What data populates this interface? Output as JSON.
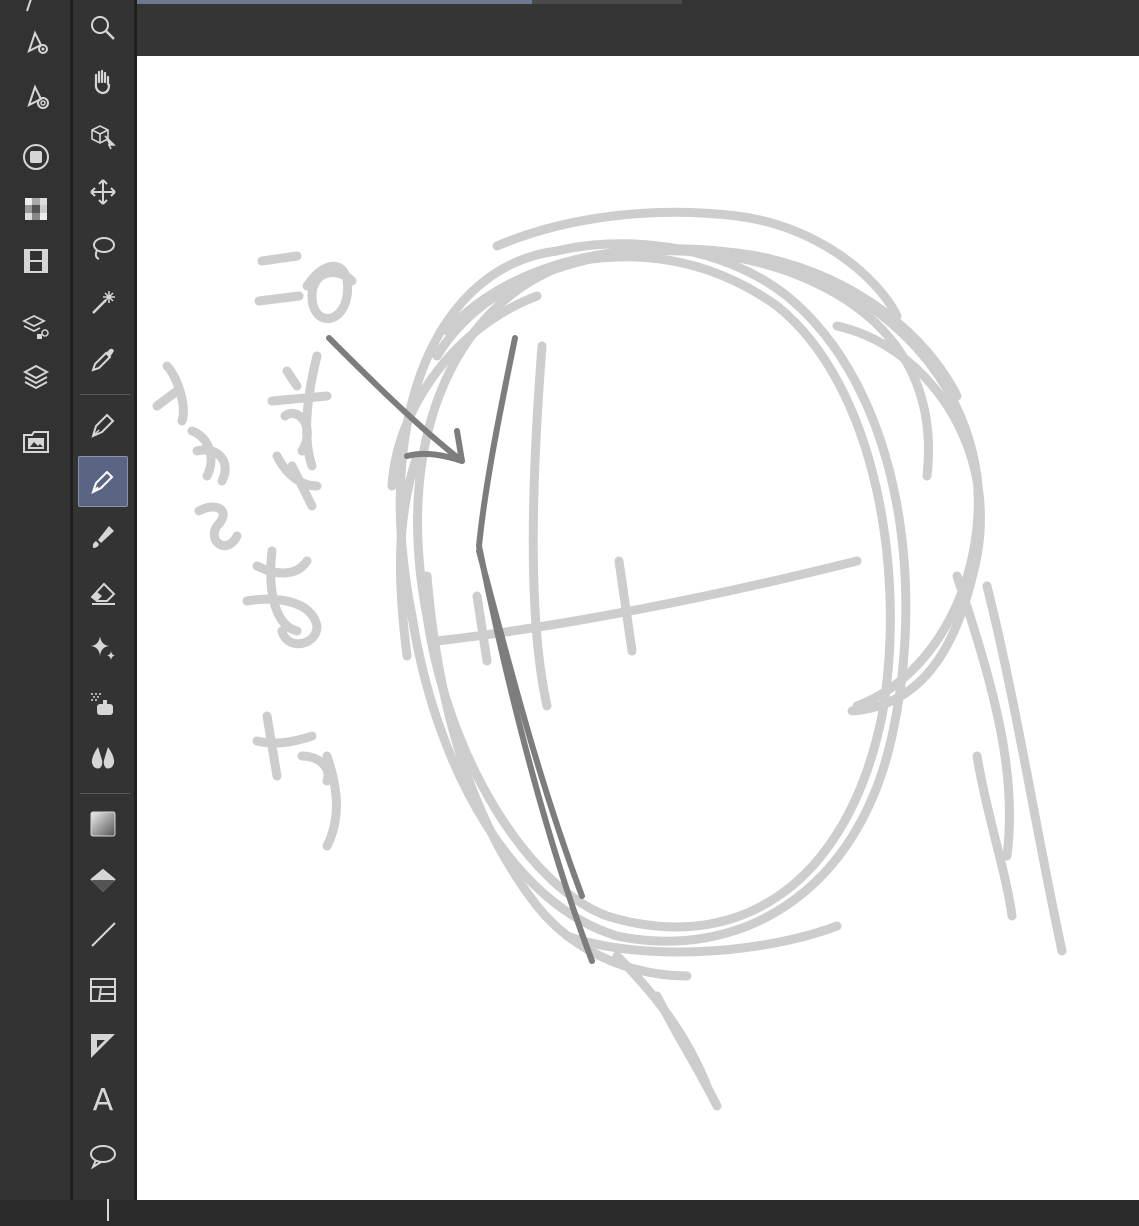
{
  "canvas": {
    "annotation_line": "この線を",
    "annotation_insert": "入れる",
    "annotation_guide": "あたり"
  },
  "toolbar": {
    "text_tool_glyph": "A",
    "selected_tool": "pen-icon-selected",
    "colors": {
      "background": "#333333",
      "selected": "#5b6583",
      "icon": "#d6d6d6",
      "canvas": "#ffffff",
      "sketch_light": "#c9c9c9",
      "sketch_dark": "#6e6e6e"
    }
  },
  "left_panel_icons": [
    "vector-tool-icon",
    "pen-settings-icon",
    "pen-target-icon",
    "navigator-icon",
    "color-set-icon",
    "animation-icon",
    "layer-property-icon",
    "layers-icon",
    "material-icon"
  ],
  "tool_icons": [
    "zoom-icon",
    "hand-icon",
    "object-3d-icon",
    "move-icon",
    "lasso-icon",
    "magic-wand-icon",
    "eyedropper-icon",
    "pen-icon",
    "pencil-icon",
    "brush-icon",
    "eraser-icon",
    "decoration-icon",
    "airbrush-icon",
    "blend-icon",
    "gradient-icon",
    "fill-icon",
    "line-icon",
    "frame-icon",
    "ruler-icon",
    "text-icon",
    "balloon-icon"
  ]
}
